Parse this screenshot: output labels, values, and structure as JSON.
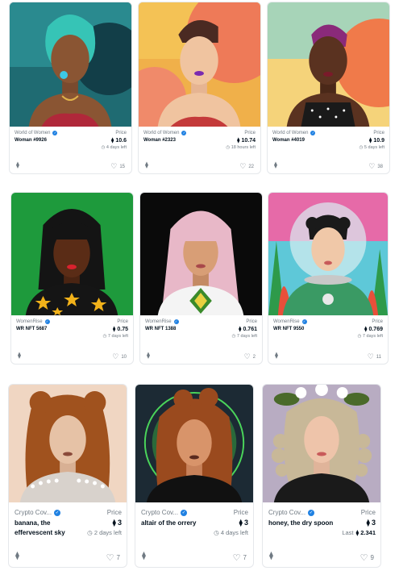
{
  "currency_symbol": "⧫",
  "cards": [
    {
      "collection": "World of Women",
      "name": "Woman #9926",
      "price_label": "Price",
      "price": "10.6",
      "time": "4 days left",
      "favorites": "15"
    },
    {
      "collection": "World of Women",
      "name": "Woman #2323",
      "price_label": "Price",
      "price": "10.74",
      "time": "18 hours left",
      "favorites": "22"
    },
    {
      "collection": "World of Women",
      "name": "Woman #4019",
      "price_label": "Price",
      "price": "10.9",
      "time": "5 days left",
      "favorites": "38"
    },
    {
      "collection": "WomenRise",
      "name": "WR NFT 5687",
      "price_label": "Price",
      "price": "0.75",
      "time": "7 days left",
      "favorites": "10"
    },
    {
      "collection": "WomenRise",
      "name": "WR NFT 1388",
      "price_label": "Price",
      "price": "0.761",
      "time": "7 days left",
      "favorites": "2"
    },
    {
      "collection": "WomenRise",
      "name": "WR NFT 9550",
      "price_label": "Price",
      "price": "0.769",
      "time": "7 days left",
      "favorites": "11"
    },
    {
      "collection": "Crypto Cov...",
      "name": "banana, the effervescent sky",
      "price_label": "Price",
      "price": "3",
      "time": "2 days left",
      "favorites": "7"
    },
    {
      "collection": "Crypto Cov...",
      "name": "altair of the orrery",
      "price_label": "Price",
      "price": "3",
      "time": "4 days left",
      "favorites": "7"
    },
    {
      "collection": "Crypto Cov...",
      "name": "honey, the dry spoon",
      "price_label": "Price",
      "price": "3",
      "last_label": "Last",
      "last_price": "2.341",
      "favorites": "9"
    }
  ],
  "colors": {
    "verified": "#2081e2",
    "text_primary": "#04111d",
    "text_secondary": "#707a83",
    "border": "#e5e8eb"
  },
  "icons": {
    "verified": "verified-badge-icon",
    "clock": "clock-icon",
    "eth": "ethereum-icon",
    "heart": "heart-icon"
  }
}
